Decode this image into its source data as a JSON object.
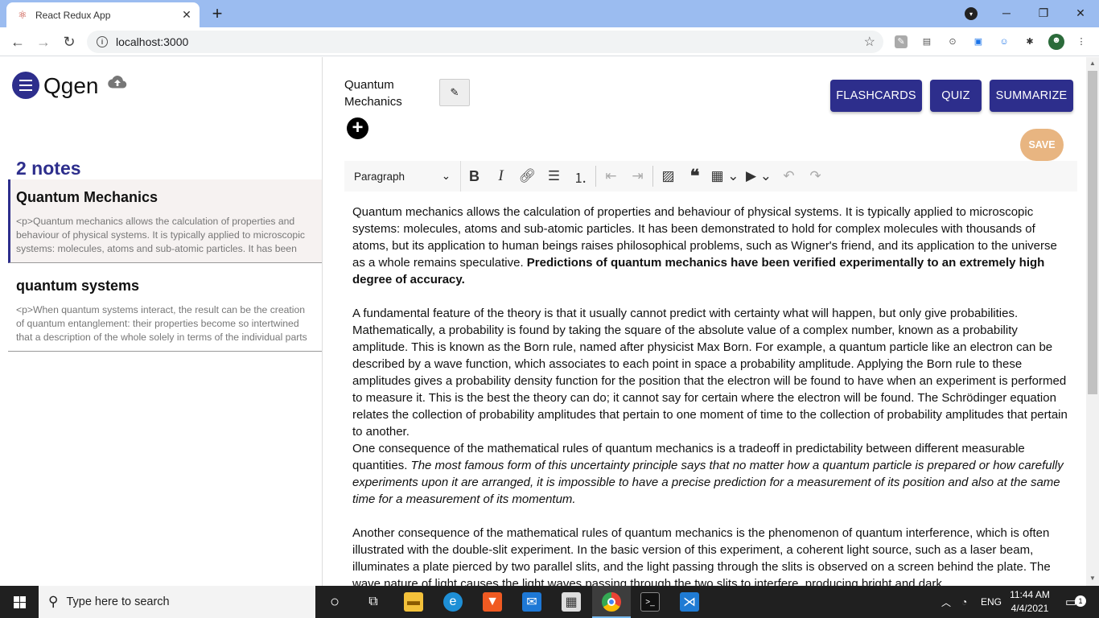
{
  "browser": {
    "tab_title": "React Redux App",
    "url": "localhost:3000"
  },
  "app": {
    "brand": "Qgen",
    "notes_count": "2 notes",
    "notes": [
      {
        "title": "Quantum Mechanics",
        "preview": "<p>Quantum mechanics allows the calculation of properties and behaviour of physical systems. It is typically applied to microscopic systems: molecules, atoms and sub-atomic particles. It has been demonstrated to hold for complex"
      },
      {
        "title": "quantum systems",
        "preview": "<p>When quantum systems interact, the result can be the creation of quantum entanglement: their properties become so intertwined that a description of the whole solely in terms of the individual parts is no longer possible. Erwin"
      }
    ]
  },
  "editor": {
    "doc_title": "Quantum Mechanics",
    "flashcards_label": "FLASHCARDS",
    "quiz_label": "QUIZ",
    "summarize_label": "SUMMARIZE",
    "save_label": "SAVE",
    "paragraph_select": "Paragraph",
    "content": {
      "p1_normal": "Quantum mechanics allows the calculation of properties and behaviour of physical systems. It is typically applied to microscopic systems: molecules, atoms and sub-atomic particles. It has been demonstrated to hold for complex molecules with thousands of atoms, but its application to human beings raises philosophical problems, such as Wigner's friend, and its application to the universe as a whole remains speculative. ",
      "p1_bold": "Predictions of quantum mechanics have been verified experimentally to an extremely high degree of accuracy.",
      "p2": "A fundamental feature of the theory is that it usually cannot predict with certainty what will happen, but only give probabilities. Mathematically, a probability is found by taking the square of the absolute value of a complex number, known as a probability amplitude. This is known as the Born rule, named after physicist Max Born. For example, a quantum particle like an electron can be described by a wave function, which associates to each point in space a probability amplitude. Applying the Born rule to these amplitudes gives a probability density function for the position that the electron will be found to have when an experiment is performed to measure it. This is the best the theory can do; it cannot say for certain where the electron will be found. The Schrödinger equation relates the collection of probability amplitudes that pertain to one moment of time to the collection of probability amplitudes that pertain to another.",
      "p3_normal": "One consequence of the mathematical rules of quantum mechanics is a tradeoff in predictability between different measurable quantities. ",
      "p3_italic": "The most famous form of this uncertainty principle says that no matter how a quantum particle is prepared or how carefully experiments upon it are arranged, it is impossible to have a precise prediction for a measurement of its position and also at the same time for a measurement of its momentum.",
      "p4": "Another consequence of the mathematical rules of quantum mechanics is the phenomenon of quantum interference, which is often illustrated with the double-slit experiment. In the basic version of this experiment, a coherent light source, such as a laser beam, illuminates a plate pierced by two parallel slits, and the light passing through the slits is observed on a screen behind the plate. The wave nature of light causes the light waves passing through the two slits to interfere, producing bright and dark"
    }
  },
  "taskbar": {
    "search_placeholder": "Type here to search",
    "language": "ENG",
    "time": "11:44 AM",
    "date": "4/4/2021",
    "notification_count": "1"
  },
  "colors": {
    "primary": "#2d2e8c",
    "save": "#e8b581"
  }
}
